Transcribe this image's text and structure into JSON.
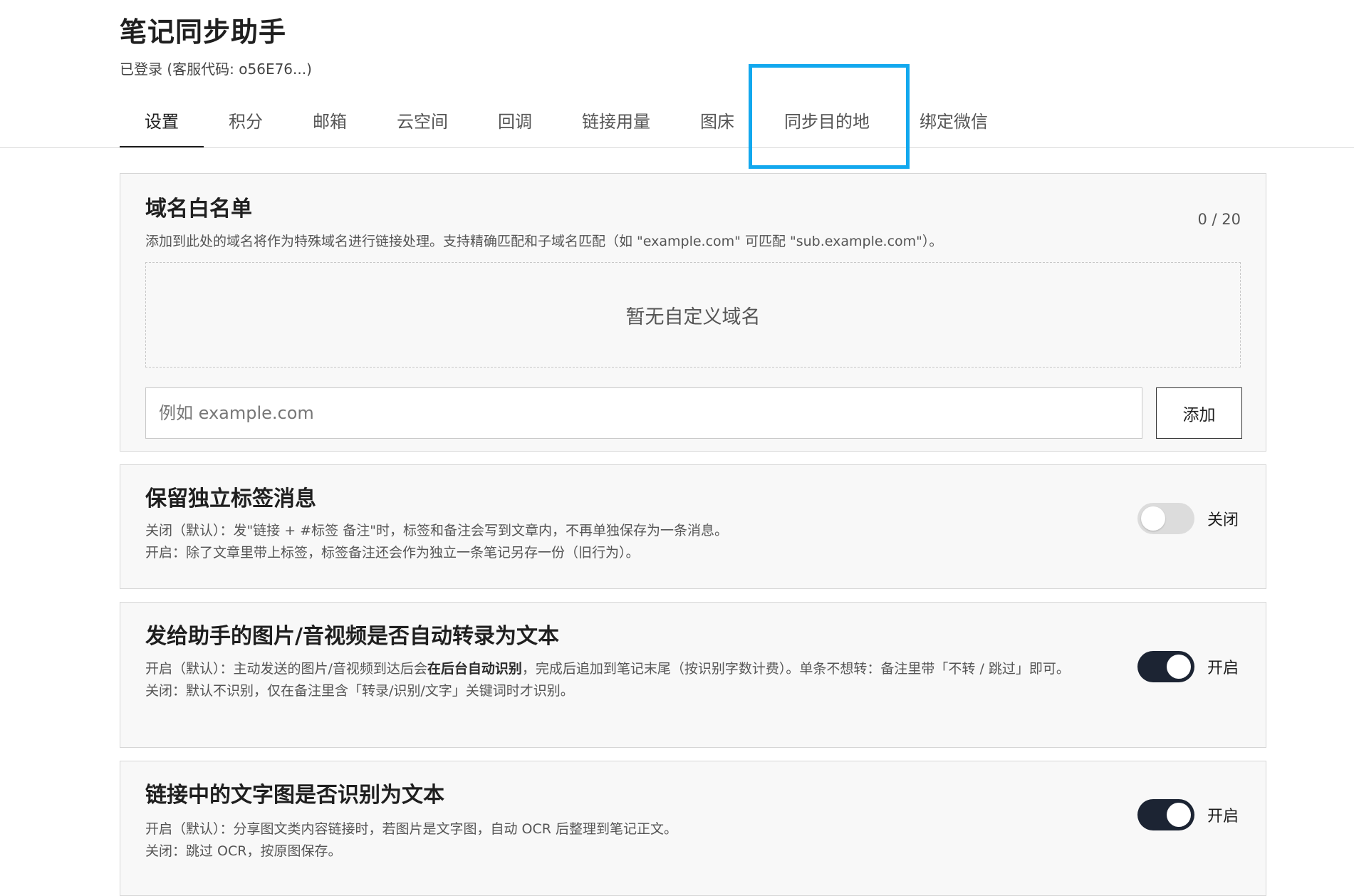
{
  "header": {
    "title": "笔记同步助手",
    "login_status": "已登录 (客服代码: o56E76...)"
  },
  "tabs": [
    {
      "label": "设置"
    },
    {
      "label": "积分"
    },
    {
      "label": "邮箱"
    },
    {
      "label": "云空间"
    },
    {
      "label": "回调"
    },
    {
      "label": "链接用量"
    },
    {
      "label": "图床"
    },
    {
      "label": "同步目的地"
    },
    {
      "label": "绑定微信"
    }
  ],
  "whitelist": {
    "title": "域名白名单",
    "description": "添加到此处的域名将作为特殊域名进行链接处理。支持精确匹配和子域名匹配（如 \"example.com\" 可匹配 \"sub.example.com\"）。",
    "counter": "0 / 20",
    "empty_text": "暂无自定义域名",
    "input_placeholder": "例如 example.com",
    "add_label": "添加"
  },
  "tag_setting": {
    "title": "保留独立标签消息",
    "line1": "关闭（默认）：发\"链接 + #标签 备注\"时，标签和备注会写到文章内，不再单独保存为一条消息。",
    "line2": "开启：除了文章里带上标签，标签备注还会作为独立一条笔记另存一份（旧行为）。",
    "state_label": "关闭"
  },
  "media_setting": {
    "title": "发给助手的图片/音视频是否自动转录为文本",
    "line1_pre": "开启（默认）：主动发送的图片/音视频到达后会",
    "line1_bold": "在后台自动识别",
    "line1_post": "，完成后追加到笔记末尾（按识别字数计费）。单条不想转：备注里带「不转 / 跳过」即可。",
    "line2": "关闭：默认不识别，仅在备注里含「转录/识别/文字」关键词时才识别。",
    "state_label": "开启"
  },
  "ocr_setting": {
    "title": "链接中的文字图是否识别为文本",
    "line1": "开启（默认）：分享图文类内容链接时，若图片是文字图，自动 OCR 后整理到笔记正文。",
    "line2": "关闭：跳过 OCR，按原图保存。",
    "state_label": "开启"
  }
}
